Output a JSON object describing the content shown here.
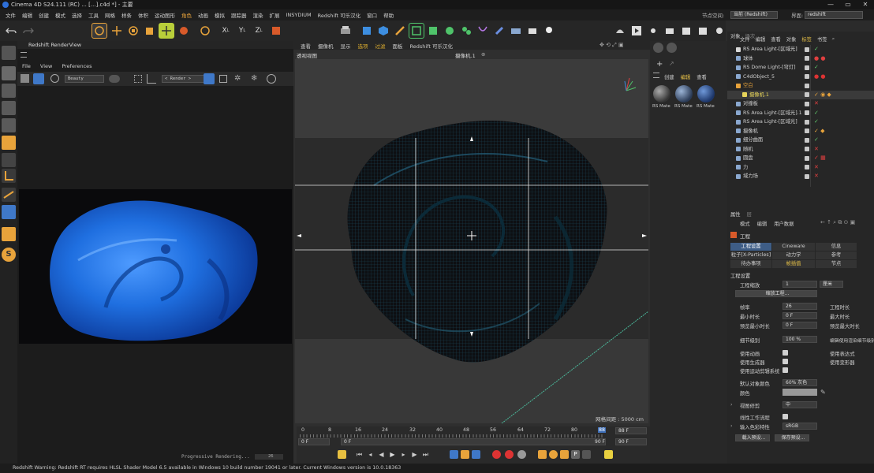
{
  "app": {
    "title": "Cinema 4D S24.111 (RC)  ...  [...].c4d *] - 主要",
    "window_controls": [
      "—",
      "▭",
      "✕"
    ]
  },
  "menubar": {
    "items": [
      "文件",
      "编辑",
      "创建",
      "模式",
      "选择",
      "工具",
      "网格",
      "样条",
      "体积",
      "运动图形",
      "角色",
      "动画",
      "模拟",
      "跟踪器",
      "渲染",
      "扩展",
      "INSYDIUM",
      "Redshift 可乐汉化",
      "窗口",
      "帮助"
    ],
    "highlight_index": 10,
    "node_space_label": "节点空间:",
    "node_space_value": "当前 (Redshift)",
    "interface_label": "界面:",
    "interface_value": "redshift"
  },
  "renderview": {
    "title": "Redshift RenderView",
    "menu": [
      "File",
      "View",
      "Preferences"
    ],
    "beauty_combo": "Beauty",
    "render_combo": "< Render >",
    "status_text": "Progressive Rendering...",
    "progress_text": "26"
  },
  "viewport": {
    "menu": [
      "查看",
      "摄像机",
      "显示",
      "选项",
      "过滤",
      "面板",
      "Redshift 可乐汉化"
    ],
    "highlight_indices": [
      3,
      4
    ],
    "view_name": "透视视图",
    "camera_name": "摄像机.1",
    "grid_info": "网格间距 : 5000 cm"
  },
  "timeline": {
    "ticks": [
      "0",
      "8",
      "16",
      "24",
      "32",
      "40",
      "48",
      "56",
      "64",
      "72",
      "80",
      "88"
    ],
    "current_frame_marker": "88",
    "end_frame_field": "88 F",
    "start_field": "0 F",
    "min_field": "0 F",
    "max_field": "90 F",
    "max_field2": "90 F"
  },
  "materials": {
    "menu": [
      "创建",
      "编辑",
      "查看"
    ],
    "items": [
      "RS Mate",
      "RS Mate",
      "RS Mate"
    ]
  },
  "objects": {
    "tabs": [
      "对象",
      "场次"
    ],
    "menu": [
      "文件",
      "编辑",
      "查看",
      "对象",
      "标签",
      "书签"
    ],
    "rows": [
      {
        "name": "RS Area Light-[区域光]",
        "indent": 0,
        "color": "#d9d9d9",
        "tags": "✓",
        "tagcolor": "#5fc76a"
      },
      {
        "name": "球体",
        "indent": 0,
        "color": "#cfcfcf",
        "tags": "● ●",
        "tagcolor": "#e04040"
      },
      {
        "name": "RS Dome Light-[穹灯]",
        "indent": 0,
        "color": "#cfcfcf",
        "tags": "✓",
        "tagcolor": "#5fc76a"
      },
      {
        "name": "C4dObject_5",
        "indent": 0,
        "color": "#cfcfcf",
        "tags": "● ●",
        "tagcolor": "#d33"
      },
      {
        "name": "空白",
        "indent": 0,
        "color": "#e8a33b",
        "tags": "",
        "tagcolor": "#5fc76a"
      },
      {
        "name": "摄像机.1",
        "indent": 1,
        "color": "#e6d35a",
        "tags": "✓ ◉ ◆",
        "tagcolor": "#e8a33b"
      },
      {
        "name": "对撞板",
        "indent": 0,
        "color": "#cfcfcf",
        "tags": "✕",
        "tagcolor": "#e04040"
      },
      {
        "name": "RS Area Light-[区域光].1",
        "indent": 0,
        "color": "#cfcfcf",
        "tags": "✓",
        "tagcolor": "#5fc76a"
      },
      {
        "name": "RS Area Light-[区域光]",
        "indent": 0,
        "color": "#cfcfcf",
        "tags": "✓",
        "tagcolor": "#5fc76a"
      },
      {
        "name": "摄像机",
        "indent": 0,
        "color": "#cfcfcf",
        "tags": "✓ ◆",
        "tagcolor": "#e8a33b"
      },
      {
        "name": "细分曲面",
        "indent": 0,
        "color": "#cfcfcf",
        "tags": "✓",
        "tagcolor": "#5fc76a"
      },
      {
        "name": "随机",
        "indent": 0,
        "color": "#cfcfcf",
        "tags": "✕",
        "tagcolor": "#e04040"
      },
      {
        "name": "圆盘",
        "indent": 0,
        "color": "#cfcfcf",
        "tags": "✓ ▦",
        "tagcolor": "#e04040"
      },
      {
        "name": "力",
        "indent": 0,
        "color": "#cfcfcf",
        "tags": "✕",
        "tagcolor": "#e04040"
      },
      {
        "name": "域力场",
        "indent": 0,
        "color": "#cfcfcf",
        "tags": "✕",
        "tagcolor": "#e04040"
      }
    ]
  },
  "attributes": {
    "tabs": [
      "属性",
      "层"
    ],
    "menu": [
      "模式",
      "编辑",
      "用户数据"
    ],
    "section": "工程",
    "tab_grid": [
      [
        "工程设置",
        "Cineware",
        "信息"
      ],
      [
        "粒子[X-Particles]",
        "动力学",
        "参考"
      ],
      [
        "待办事项",
        "帧插值",
        "节点"
      ]
    ],
    "group_title": "工程设置",
    "scale_label": "工程缩放",
    "scale_value": "1",
    "scale_unit": "厘米",
    "scale_button": "缩放工程...",
    "fps_label": "帧率",
    "fps_value": "26",
    "project_len_label": "工程时长",
    "min_time_label": "最小时长",
    "min_time_value": "0 F",
    "max_time_label": "最大时长",
    "preview_min_label": "预览最小时长",
    "preview_min_value": "0 F",
    "preview_max_label": "预览最大时长",
    "lod_label": "细节级别",
    "lod_value": "100 %",
    "render_lod_label": "编辑使用渲染细节级别",
    "anim_label": "使用动画",
    "expr_label": "使用表达式",
    "gen_label": "使用生成器",
    "deform_label": "使用变形器",
    "motion_label": "使用运动剪辑系统",
    "obj_color_label": "默认对象颜色",
    "obj_color_value": "60% 灰色",
    "color_label": "颜色",
    "view_clip_label": "视图修剪",
    "view_clip_value": "中",
    "linear_label": "线性工作流程",
    "input_color_label": "输入色彩特性",
    "input_color_value": "sRGB",
    "load_button": "载入预设...",
    "save_button": "保存预设..."
  },
  "statusbar": {
    "text": "Redshift Warning: Redshift RT requires HLSL Shader Model 6.5 available in Windows 10 build number 19041 or later. Current Windows version is 10.0.18363"
  },
  "colors": {
    "accent": "#e8a33b",
    "selected_tab": "#3e5d86",
    "render_blue": "#1f6fe0",
    "mesh_teal": "#1b4a5e"
  }
}
